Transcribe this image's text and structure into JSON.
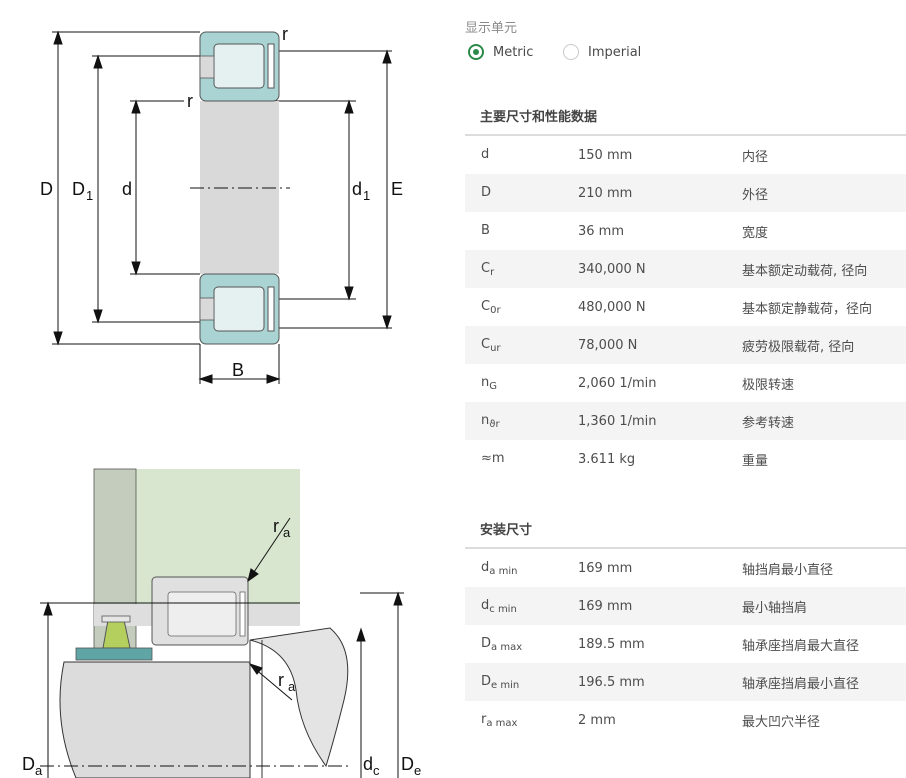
{
  "drawing_top": {
    "labels": {
      "D": "D",
      "D1_main": "D",
      "D1_sub": "1",
      "d": "d",
      "d1_main": "d",
      "d1_sub": "1",
      "E": "E",
      "B": "B",
      "r_top": "r",
      "r_inner": "r"
    }
  },
  "drawing_bottom": {
    "labels": {
      "ra_top_main": "r",
      "ra_top_sub": "a",
      "ra_bottom_main": "r",
      "ra_bottom_sub": "a",
      "Da_main": "D",
      "Da_sub": "a",
      "dc_main": "d",
      "dc_sub": "c",
      "De_main": "D",
      "De_sub": "e"
    }
  },
  "units": {
    "title": "显示单元",
    "options": [
      {
        "label": "Metric",
        "selected": true
      },
      {
        "label": "Imperial",
        "selected": false
      }
    ]
  },
  "main_data": {
    "title": "主要尺寸和性能数据",
    "rows": [
      {
        "sym": "d",
        "sub": "",
        "value": "150 mm",
        "desc": "内径"
      },
      {
        "sym": "D",
        "sub": "",
        "value": "210 mm",
        "desc": "外径"
      },
      {
        "sym": "B",
        "sub": "",
        "value": "36 mm",
        "desc": "宽度"
      },
      {
        "sym": "C",
        "sub": "r",
        "value": "340,000 N",
        "desc": "基本额定动载荷, 径向"
      },
      {
        "sym": "C",
        "sub": "0r",
        "value": "480,000 N",
        "desc": "基本额定静载荷，径向"
      },
      {
        "sym": "C",
        "sub": "ur",
        "value": "78,000 N",
        "desc": "疲劳极限载荷, 径向"
      },
      {
        "sym": "n",
        "sub": "G",
        "value": "2,060 1/min",
        "desc": "极限转速"
      },
      {
        "sym": "n",
        "sub": "ϑr",
        "value": "1,360 1/min",
        "desc": "参考转速"
      },
      {
        "sym": "≈m",
        "sub": "",
        "value": "3.611 kg",
        "desc": "重量"
      }
    ]
  },
  "mounting": {
    "title": "安装尺寸",
    "rows": [
      {
        "sym": "d",
        "sub": "a min",
        "value": "169 mm",
        "desc": "轴挡肩最小直径"
      },
      {
        "sym": "d",
        "sub": "c min",
        "value": "169 mm",
        "desc": "最小轴挡肩"
      },
      {
        "sym": "D",
        "sub": "a max",
        "value": "189.5 mm",
        "desc": "轴承座挡肩最大直径"
      },
      {
        "sym": "D",
        "sub": "e min",
        "value": "196.5 mm",
        "desc": "轴承座挡肩最小直径"
      },
      {
        "sym": "r",
        "sub": "a max",
        "value": "2 mm",
        "desc": "最大凹穴半径"
      }
    ]
  },
  "colors": {
    "accent": "#2b8a4a",
    "bearing_teal": "#a9d4d3",
    "bearing_gray": "#d9d9d9",
    "housing_green": "#d9e6cf",
    "shaft_gray": "#c4cdbd"
  }
}
